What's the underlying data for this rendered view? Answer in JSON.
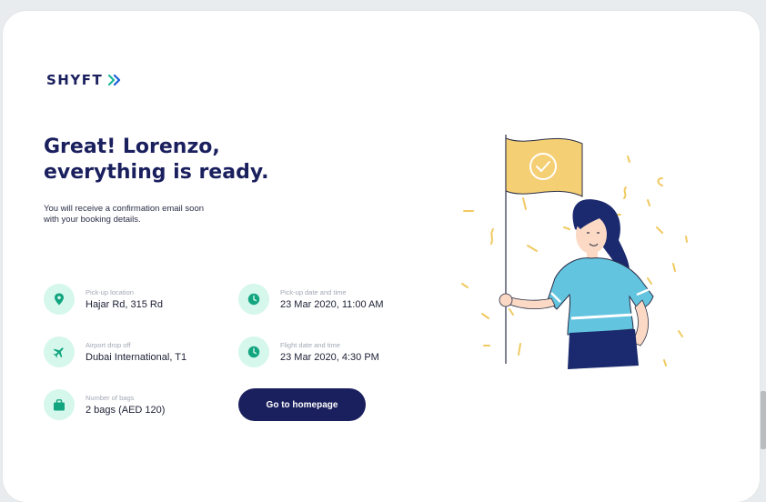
{
  "brand": {
    "name": "SHYFT",
    "icon": "double-chevron-right-icon",
    "color": "#1a1f5e",
    "accent": "#1bb89a"
  },
  "headline": {
    "line1": "Great! Lorenzo,",
    "line2": "everything is ready."
  },
  "subtext": {
    "line1": "You will receive a confirmation email soon",
    "line2": "with your booking details."
  },
  "details": {
    "pickup_location": {
      "label": "Pick-up location",
      "value": "Hajar Rd, 315 Rd",
      "icon": "location-pin-icon"
    },
    "pickup_datetime": {
      "label": "Pick-up date and time",
      "value": "23 Mar 2020, 11:00 AM",
      "icon": "clock-icon"
    },
    "airport_dropoff": {
      "label": "Airport drop off",
      "value": "Dubai International, T1",
      "icon": "airplane-icon"
    },
    "flight_datetime": {
      "label": "Flight date and time",
      "value": "23 Mar 2020, 4:30 PM",
      "icon": "clock-icon"
    },
    "bags": {
      "label": "Number of bags",
      "value": "2 bags (AED 120)",
      "icon": "bag-icon"
    }
  },
  "actions": {
    "homepage_label": "Go to homepage"
  }
}
